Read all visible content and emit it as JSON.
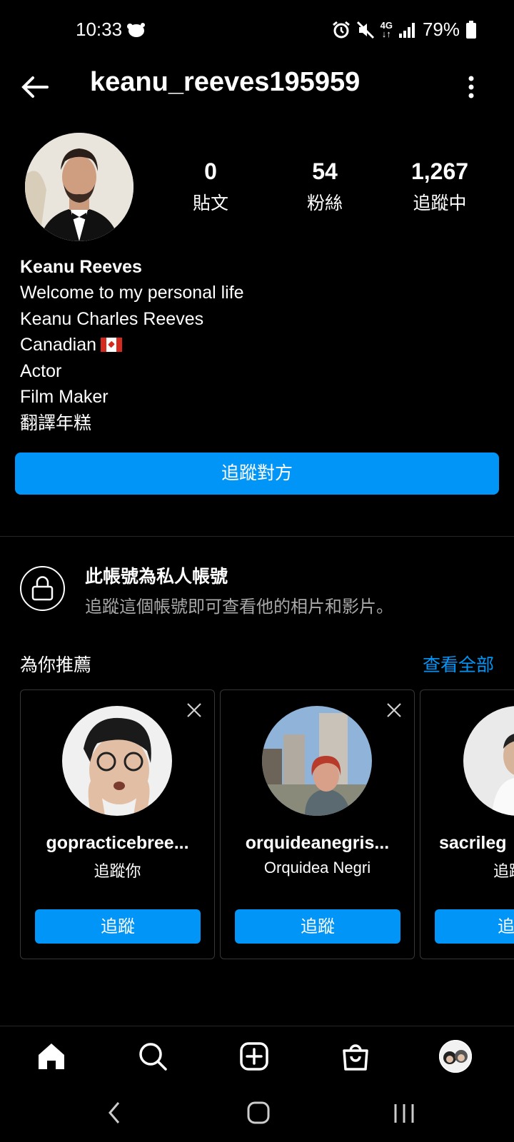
{
  "status_bar": {
    "time": "10:33",
    "network": "4G",
    "battery": "79%"
  },
  "header": {
    "username": "keanu_reeves195959"
  },
  "stats": [
    {
      "value": "0",
      "label": "貼文"
    },
    {
      "value": "54",
      "label": "粉絲"
    },
    {
      "value": "1,267",
      "label": "追蹤中"
    }
  ],
  "bio": {
    "name": "Keanu Reeves",
    "lines": [
      "Welcome to my personal life",
      "Keanu Charles Reeves",
      "Canadian",
      "Actor",
      "Film Maker",
      "翻譯年糕"
    ]
  },
  "follow_button": "追蹤對方",
  "private_notice": {
    "title": "此帳號為私人帳號",
    "description": "追蹤這個帳號即可查看他的相片和影片。"
  },
  "suggestions": {
    "title": "為你推薦",
    "see_all": "查看全部",
    "cards": [
      {
        "username": "gopracticebree...",
        "subtitle": "追蹤你",
        "button": "追蹤"
      },
      {
        "username": "orquideanegris...",
        "subtitle": "Orquidea Negri",
        "button": "追蹤"
      },
      {
        "username": "sacrileg",
        "subtitle": "追蹤",
        "button": "追"
      }
    ]
  },
  "icons": {
    "status": [
      "fan-icon",
      "alarm-icon",
      "mute-icon",
      "signal-icon",
      "battery-icon"
    ],
    "nav": [
      "home-icon",
      "search-icon",
      "add-post-icon",
      "shop-icon",
      "profile-avatar"
    ]
  },
  "colors": {
    "accent": "#0095f6",
    "background": "#000000",
    "secondary_text": "#a8a8a8",
    "divider": "#262626"
  }
}
